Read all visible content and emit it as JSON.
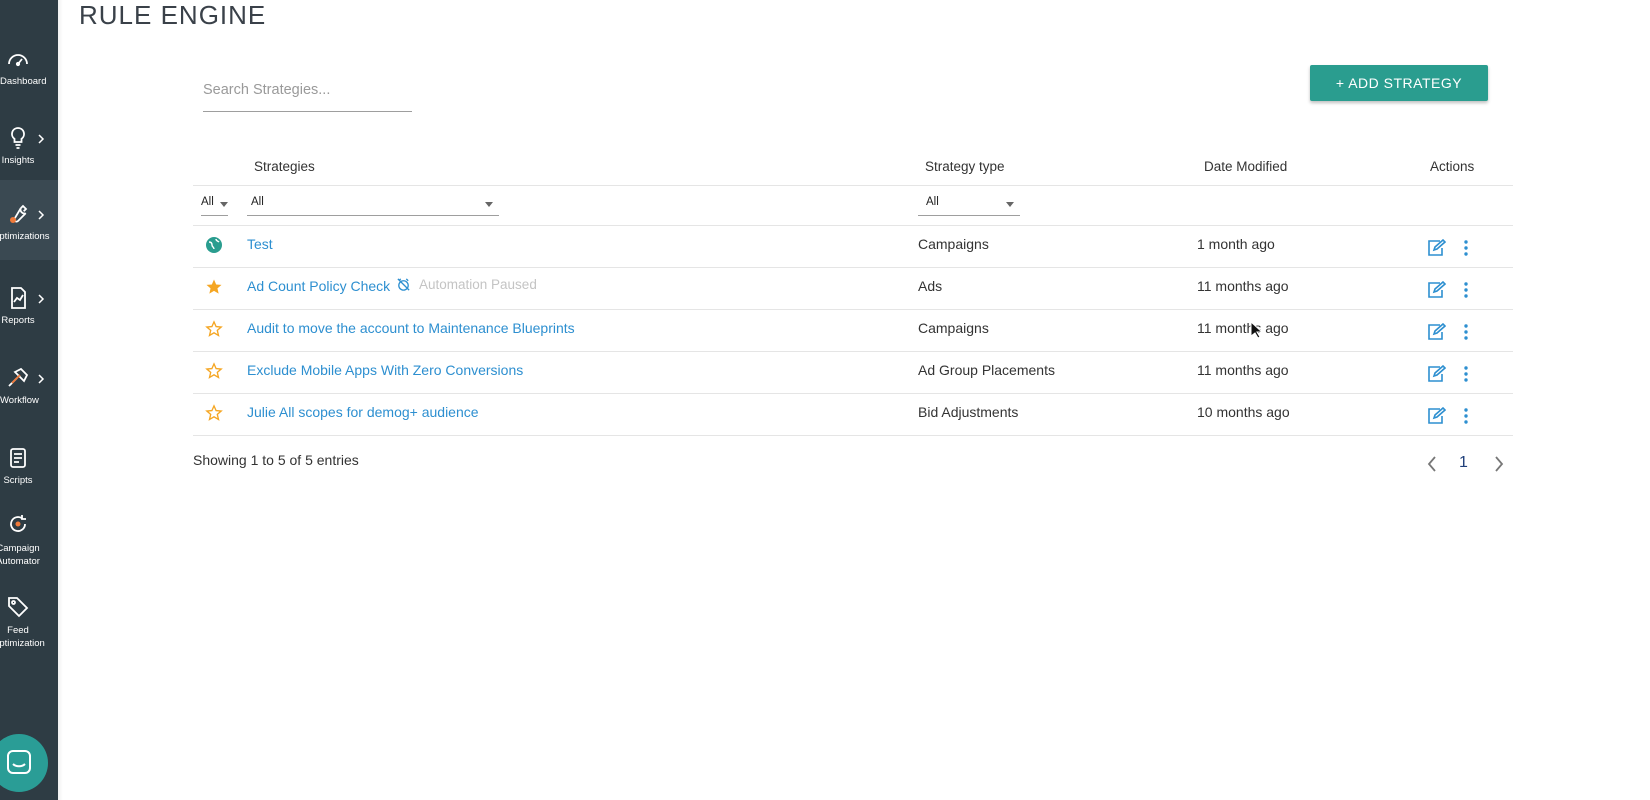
{
  "sidebar": {
    "items": [
      {
        "label": "Dashboard",
        "icon": "speedometer-icon"
      },
      {
        "label": "Insights",
        "icon": "lightbulb-icon"
      },
      {
        "label": "Optimizations",
        "icon": "wrench-icon"
      },
      {
        "label": "Reports",
        "icon": "report-chart-icon"
      },
      {
        "label": "Workflow",
        "icon": "hammer-icon"
      },
      {
        "label": "Scripts",
        "icon": "script-icon"
      },
      {
        "label": "Campaign\nAutomator",
        "icon": "campaign-automator-icon"
      },
      {
        "label": "Feed\nOptimization",
        "icon": "tag-icon"
      }
    ],
    "active_index": 2,
    "chat_icon": "chat-icon"
  },
  "page": {
    "title": "RULE ENGINE",
    "search_placeholder": "Search Strategies...",
    "add_button_label": "+ ADD STRATEGY"
  },
  "table": {
    "headers": {
      "strategies": "Strategies",
      "strategy_type": "Strategy type",
      "date_modified": "Date Modified",
      "actions": "Actions"
    },
    "filters": {
      "icon_filter": "All",
      "strategy_filter": "All",
      "type_filter": "All"
    },
    "rows": [
      {
        "icon": "globe-icon",
        "name": "Test",
        "status": "",
        "type": "Campaigns",
        "date": "1 month ago"
      },
      {
        "icon": "star-filled-icon",
        "name": "Ad Count Policy Check",
        "status": "Automation Paused",
        "type": "Ads",
        "date": "11 months ago"
      },
      {
        "icon": "star-outline-icon",
        "name": "Audit to move the account to Maintenance Blueprints",
        "status": "",
        "type": "Campaigns",
        "date": "11 months ago"
      },
      {
        "icon": "star-outline-icon",
        "name": "Exclude Mobile Apps With Zero Conversions",
        "status": "",
        "type": "Ad Group Placements",
        "date": "11 months ago"
      },
      {
        "icon": "star-outline-icon",
        "name": "Julie All scopes for demog+ audience",
        "status": "",
        "type": "Bid Adjustments",
        "date": "10 months ago"
      }
    ]
  },
  "footer": {
    "showing": "Showing 1 to 5 of 5 entries",
    "current_page": "1"
  },
  "colors": {
    "sidebar": "#2e3c44",
    "accent": "#2a9d8f",
    "link": "#2d8fd0",
    "star": "#f5a623"
  }
}
